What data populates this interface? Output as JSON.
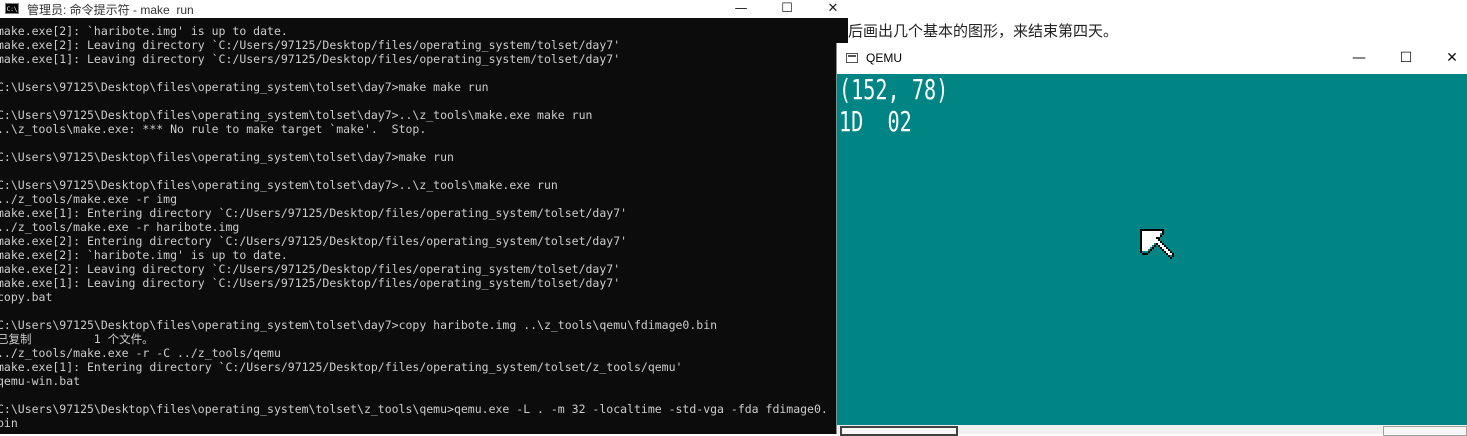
{
  "cmd": {
    "title": "管理员: 命令提示符 - make  run",
    "icon": "cmd-icon",
    "controls": {
      "minimize": "—",
      "maximize": "☐",
      "close": "✕"
    },
    "lines": [
      "make.exe[2]: `haribote.img' is up to date.",
      "make.exe[2]: Leaving directory `C:/Users/97125/Desktop/files/operating_system/tolset/day7'",
      "make.exe[1]: Leaving directory `C:/Users/97125/Desktop/files/operating_system/tolset/day7'",
      "",
      "C:\\Users\\97125\\Desktop\\files\\operating_system\\tolset\\day7>make make run",
      "",
      "C:\\Users\\97125\\Desktop\\files\\operating_system\\tolset\\day7>..\\z_tools\\make.exe make run",
      "..\\z_tools\\make.exe: *** No rule to make target `make'.  Stop.",
      "",
      "C:\\Users\\97125\\Desktop\\files\\operating_system\\tolset\\day7>make run",
      "",
      "C:\\Users\\97125\\Desktop\\files\\operating_system\\tolset\\day7>..\\z_tools\\make.exe run",
      "../z_tools/make.exe -r img",
      "make.exe[1]: Entering directory `C:/Users/97125/Desktop/files/operating_system/tolset/day7'",
      "../z_tools/make.exe -r haribote.img",
      "make.exe[2]: Entering directory `C:/Users/97125/Desktop/files/operating_system/tolset/day7'",
      "make.exe[2]: `haribote.img' is up to date.",
      "make.exe[2]: Leaving directory `C:/Users/97125/Desktop/files/operating_system/tolset/day7'",
      "make.exe[1]: Leaving directory `C:/Users/97125/Desktop/files/operating_system/tolset/day7'",
      "copy.bat",
      "",
      "C:\\Users\\97125\\Desktop\\files\\operating_system\\tolset\\day7>copy haribote.img ..\\z_tools\\qemu\\fdimage0.bin",
      "已复制         1 个文件。",
      "../z_tools/make.exe -r -C ../z_tools/qemu",
      "make.exe[1]: Entering directory `C:/Users/97125/Desktop/files/operating_system/tolset/z_tools/qemu'",
      "qemu-win.bat",
      "",
      "C:\\Users\\97125\\Desktop\\files\\operating_system\\tolset\\z_tools\\qemu>qemu.exe -L . -m 32 -localtime -std-vga -fda fdimage0.",
      "bin"
    ]
  },
  "background_doc": {
    "text": "后画出几个基本的图形，来结束第四天。"
  },
  "qemu": {
    "title": "QEMU",
    "icon": "window-icon",
    "controls": {
      "minimize": "—",
      "maximize": "☐",
      "close": "✕"
    },
    "screen": {
      "background_color": "#008484",
      "text_color": "#ffffff",
      "mouse_coords": "(152, 78)",
      "key_info": "1D  02",
      "cursor_icon": "mouse-cursor-arrow"
    }
  }
}
